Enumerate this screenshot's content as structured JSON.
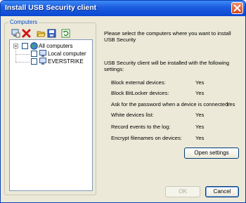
{
  "window": {
    "title": "Install USB Security client"
  },
  "computers_group": {
    "label": "Computers",
    "toolbar": [
      "add-computer-icon",
      "remove-icon",
      "open-folder-icon",
      "save-icon",
      "refresh-icon"
    ],
    "tree": {
      "root": "All computers",
      "children": [
        "Local computer",
        "EVERSTRIKE"
      ]
    }
  },
  "info": {
    "instruction": "Please select the computers where you want to install USB Security",
    "settings_intro": "USB Security client will be installed with the following settings:"
  },
  "settings": [
    {
      "label": "Block external devices:",
      "value": "Yes"
    },
    {
      "label": "Block BitLocker devices:",
      "value": "Yes"
    },
    {
      "label": "Ask for the password when a device is connected:",
      "value": "Yes"
    },
    {
      "label": "White devices list:",
      "value": "Yes"
    },
    {
      "label": "Record events to the log:",
      "value": "Yes"
    },
    {
      "label": "Encrypt filenames on devices:",
      "value": "Yes"
    }
  ],
  "buttons": {
    "open_settings": "Open settings",
    "ok": "OK",
    "cancel": "Cancel"
  },
  "colors": {
    "titlebar": "#0a47d1",
    "dialog_bg": "#ece9d8",
    "group_label": "#0046d5"
  }
}
